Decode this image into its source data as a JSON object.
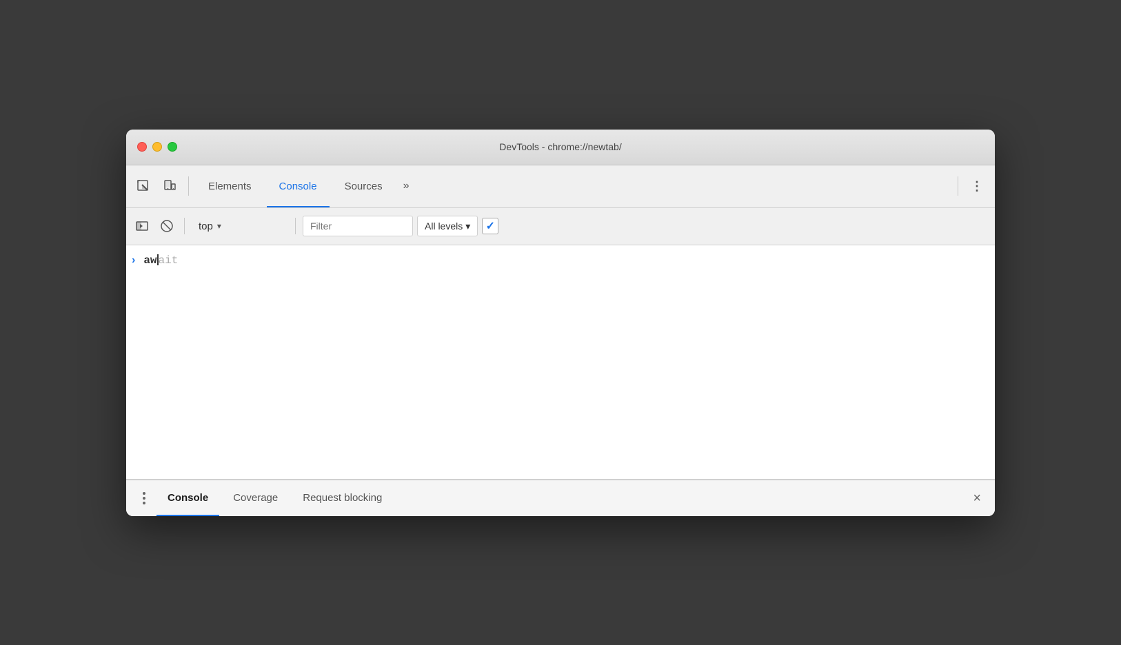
{
  "window": {
    "title": "DevTools - chrome://newtab/"
  },
  "titlebar": {
    "buttons": {
      "close_label": "close",
      "minimize_label": "minimize",
      "maximize_label": "maximize"
    }
  },
  "toolbar": {
    "inspect_icon": "inspect",
    "device_icon": "device",
    "elements_label": "Elements",
    "console_label": "Console",
    "sources_label": "Sources",
    "more_label": "»",
    "menu_label": "⋮"
  },
  "console_toolbar": {
    "sidebar_icon": "sidebar-toggle",
    "clear_icon": "clear",
    "context_label": "top",
    "context_arrow": "▾",
    "filter_placeholder": "Filter",
    "levels_label": "All levels",
    "levels_arrow": "▾",
    "checkbox_checked": "✓"
  },
  "console_output": {
    "entries": [
      {
        "prompt": ">",
        "typed_text": "aw",
        "gray_text": "ait"
      }
    ]
  },
  "drawer": {
    "menu_dots": "⋮",
    "tabs": [
      {
        "label": "Console",
        "active": true
      },
      {
        "label": "Coverage",
        "active": false
      },
      {
        "label": "Request blocking",
        "active": false
      }
    ],
    "close_label": "×"
  },
  "colors": {
    "active_tab_color": "#1a73e8",
    "close_btn": "#ff5f57",
    "minimize_btn": "#febc2e",
    "maximize_btn": "#28c840"
  }
}
